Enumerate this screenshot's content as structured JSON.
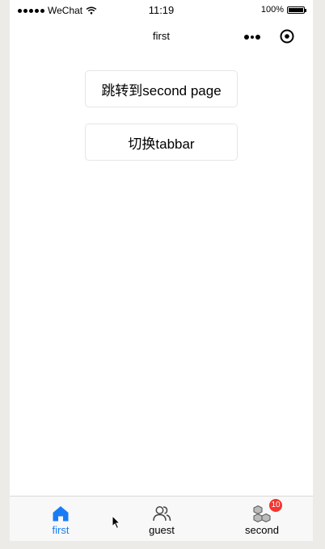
{
  "status_bar": {
    "carrier": "WeChat",
    "time": "11:19",
    "battery": "100%",
    "signal_icon": "signal-dots-icon",
    "wifi_icon": "wifi-icon",
    "battery_icon": "battery-icon"
  },
  "nav": {
    "title": "first",
    "more_icon": "more-dots-icon",
    "close_icon": "capsule-close-icon"
  },
  "buttons": {
    "navigate_label": "跳转到second page",
    "switch_tab_label": "切换tabbar"
  },
  "tabbar": {
    "active_color": "#1a7cf5",
    "items": [
      {
        "label": "first",
        "icon": "home-icon",
        "active": true
      },
      {
        "label": "guest",
        "icon": "users-icon",
        "active": false
      },
      {
        "label": "second",
        "icon": "cubes-icon",
        "active": false,
        "badge": "10"
      }
    ]
  }
}
